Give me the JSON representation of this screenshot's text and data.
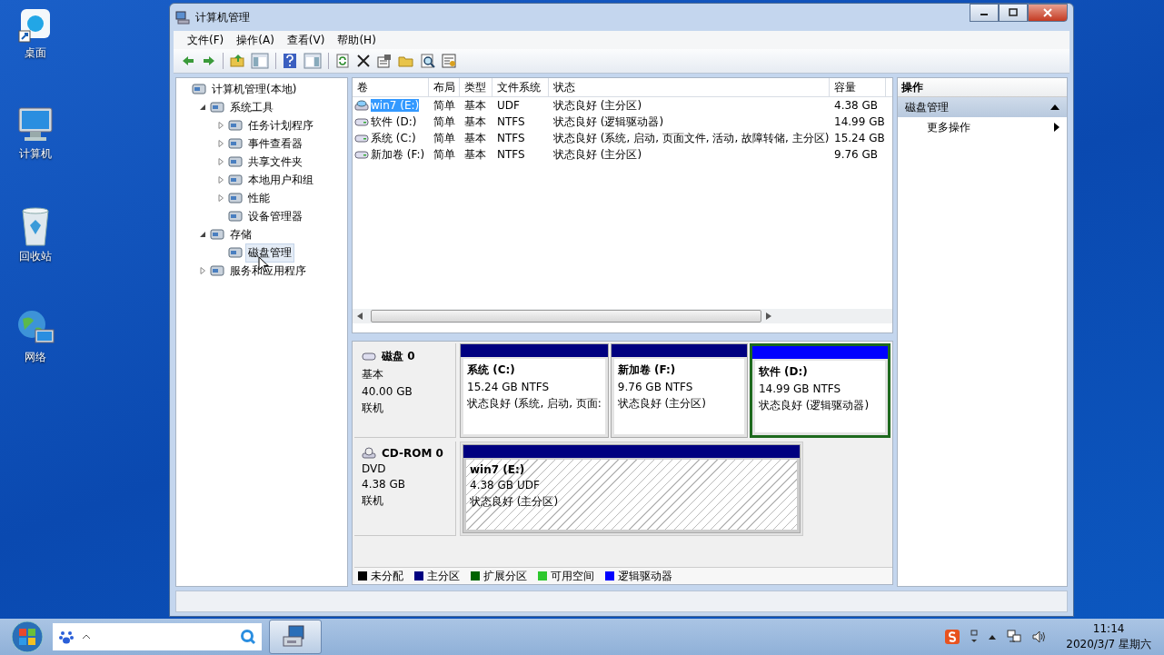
{
  "desktop_icons": [
    {
      "label": "桌面"
    },
    {
      "label": "计算机"
    },
    {
      "label": "回收站"
    },
    {
      "label": "网络"
    }
  ],
  "window": {
    "title": "计算机管理"
  },
  "menu": [
    "文件(F)",
    "操作(A)",
    "查看(V)",
    "帮助(H)"
  ],
  "tree": [
    {
      "label": "计算机管理(本地)",
      "selected": false,
      "children": [
        {
          "label": "系统工具",
          "expanded": true,
          "selected": false,
          "children": [
            {
              "label": "任务计划程序",
              "expanded": false,
              "selected": false
            },
            {
              "label": "事件查看器",
              "expanded": false,
              "selected": false
            },
            {
              "label": "共享文件夹",
              "expanded": false,
              "selected": false
            },
            {
              "label": "本地用户和组",
              "expanded": false,
              "selected": false
            },
            {
              "label": "性能",
              "expanded": false,
              "selected": false
            },
            {
              "label": "设备管理器",
              "selected": false
            }
          ]
        },
        {
          "label": "存储",
          "expanded": true,
          "selected": false,
          "children": [
            {
              "label": "磁盘管理",
              "selected": true
            }
          ]
        },
        {
          "label": "服务和应用程序",
          "expanded": false,
          "selected": false
        }
      ]
    }
  ],
  "table": {
    "columns": [
      "卷",
      "布局",
      "类型",
      "文件系统",
      "状态",
      "容量"
    ],
    "rows": [
      {
        "cells": [
          "win7 (E:)",
          "简单",
          "基本",
          "UDF",
          "状态良好 (主分区)",
          "4.38 GB"
        ],
        "kind": "optical",
        "selected": true
      },
      {
        "cells": [
          "软件 (D:)",
          "简单",
          "基本",
          "NTFS",
          "状态良好 (逻辑驱动器)",
          "14.99 GB"
        ],
        "kind": "disk",
        "selected": false
      },
      {
        "cells": [
          "系统 (C:)",
          "简单",
          "基本",
          "NTFS",
          "状态良好 (系统, 启动, 页面文件, 活动, 故障转储, 主分区)",
          "15.24 GB"
        ],
        "kind": "disk",
        "selected": false
      },
      {
        "cells": [
          "新加卷 (F:)",
          "简单",
          "基本",
          "NTFS",
          "状态良好 (主分区)",
          "9.76 GB"
        ],
        "kind": "disk",
        "selected": false
      }
    ]
  },
  "disks": [
    {
      "name": "磁盘 0",
      "kind": "disk",
      "type": "基本",
      "size": "40.00 GB",
      "state": "联机",
      "partitions": [
        {
          "label": "系统  (C:)",
          "detail": "15.24 GB NTFS",
          "status": "状态良好 (系统, 启动, 页面:",
          "color": "#000080",
          "hatched": false,
          "selected": false
        },
        {
          "label": "新加卷  (F:)",
          "detail": "9.76 GB NTFS",
          "status": "状态良好 (主分区)",
          "color": "#000080",
          "hatched": false,
          "selected": false
        },
        {
          "label": "软件  (D:)",
          "detail": "14.99 GB NTFS",
          "status": "状态良好 (逻辑驱动器)",
          "color": "#0000ff",
          "hatched": false,
          "selected": true
        }
      ]
    },
    {
      "name": "CD-ROM 0",
      "kind": "optical",
      "type": "DVD",
      "size": "4.38 GB",
      "state": "联机",
      "partitions": [
        {
          "label": "win7  (E:)",
          "detail": "4.38 GB UDF",
          "status": "状态良好 (主分区)",
          "color": "#000080",
          "hatched": true,
          "selected": false
        }
      ]
    }
  ],
  "legend": [
    {
      "label": "未分配",
      "color": "#000000"
    },
    {
      "label": "主分区",
      "color": "#000080"
    },
    {
      "label": "扩展分区",
      "color": "#006400"
    },
    {
      "label": "可用空间",
      "color": "#2ec82e"
    },
    {
      "label": "逻辑驱动器",
      "color": "#0000ff"
    }
  ],
  "actions": {
    "title": "操作",
    "section": "磁盘管理",
    "items": [
      "更多操作"
    ]
  },
  "taskbar": {
    "time": "11:14",
    "date": "2020/3/7 星期六"
  }
}
